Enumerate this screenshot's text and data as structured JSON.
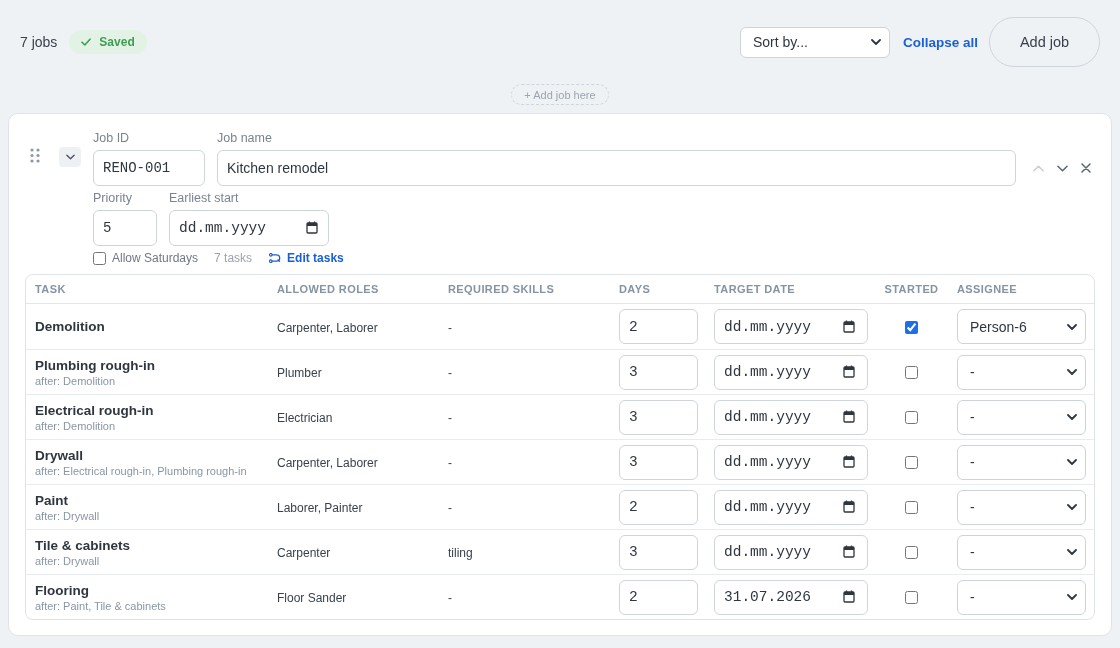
{
  "toolbar": {
    "job_count": "7 jobs",
    "status": {
      "kind": "saved",
      "label": "Saved"
    },
    "sort": {
      "value": "Sort by..."
    },
    "collapse_link": "Collapse all",
    "add_button": "Add job"
  },
  "add_job_here": {
    "label": "+ Add job here"
  },
  "job": {
    "expanded": true,
    "move_up": {
      "disabled": true
    },
    "move_down": {
      "disabled": false
    },
    "job_id": {
      "label": "Job ID",
      "value": "RENO-001"
    },
    "job_name": {
      "label": "Job name",
      "value": "Kitchen remodel"
    },
    "priority": {
      "label": "Priority",
      "value": "5"
    },
    "earliest_start": {
      "label": "Earliest start",
      "placeholder": "dd.mm.yyyy"
    },
    "allow_saturdays": {
      "label": "Allow Saturdays",
      "checked": false
    },
    "task_count": "7 tasks",
    "edit_tasks_link": "Edit tasks",
    "table": {
      "columns": [
        "TASK",
        "ALLOWED ROLES",
        "REQUIRED SKILLS",
        "DAYS",
        "TARGET DATE",
        "STARTED",
        "ASSIGNEE"
      ],
      "rows": [
        {
          "task": "Demolition",
          "allowed_roles": "Carpenter, Laborer",
          "required_skills": "-",
          "days": "2",
          "target_date": {
            "placeholder": "dd.mm.yyyy"
          },
          "started": true,
          "assignee": "Person-6"
        },
        {
          "task": "Plumbing rough-in",
          "after": "after: Demolition",
          "allowed_roles": "Plumber",
          "required_skills": "-",
          "days": "3",
          "target_date": {
            "placeholder": "dd.mm.yyyy"
          },
          "started": false,
          "assignee": "-"
        },
        {
          "task": "Electrical rough-in",
          "after": "after: Demolition",
          "allowed_roles": "Electrician",
          "required_skills": "-",
          "days": "3",
          "target_date": {
            "placeholder": "dd.mm.yyyy"
          },
          "started": false,
          "assignee": "-"
        },
        {
          "task": "Drywall",
          "after": "after: Electrical rough-in, Plumbing rough-in",
          "allowed_roles": "Carpenter, Laborer",
          "required_skills": "-",
          "days": "3",
          "target_date": {
            "placeholder": "dd.mm.yyyy"
          },
          "started": false,
          "assignee": "-"
        },
        {
          "task": "Paint",
          "after": "after: Drywall",
          "allowed_roles": "Laborer, Painter",
          "required_skills": "-",
          "days": "2",
          "target_date": {
            "placeholder": "dd.mm.yyyy"
          },
          "started": false,
          "assignee": "-"
        },
        {
          "task": "Tile & cabinets",
          "after": "after: Drywall",
          "allowed_roles": "Carpenter",
          "required_skills": "tiling",
          "days": "3",
          "target_date": {
            "placeholder": "dd.mm.yyyy"
          },
          "started": false,
          "assignee": "-"
        },
        {
          "task": "Flooring",
          "after": "after: Paint, Tile & cabinets",
          "allowed_roles": "Floor Sander",
          "required_skills": "-",
          "days": "2",
          "target_date": {
            "value": "31.07.2026"
          },
          "started": false,
          "assignee": "-"
        }
      ]
    }
  }
}
